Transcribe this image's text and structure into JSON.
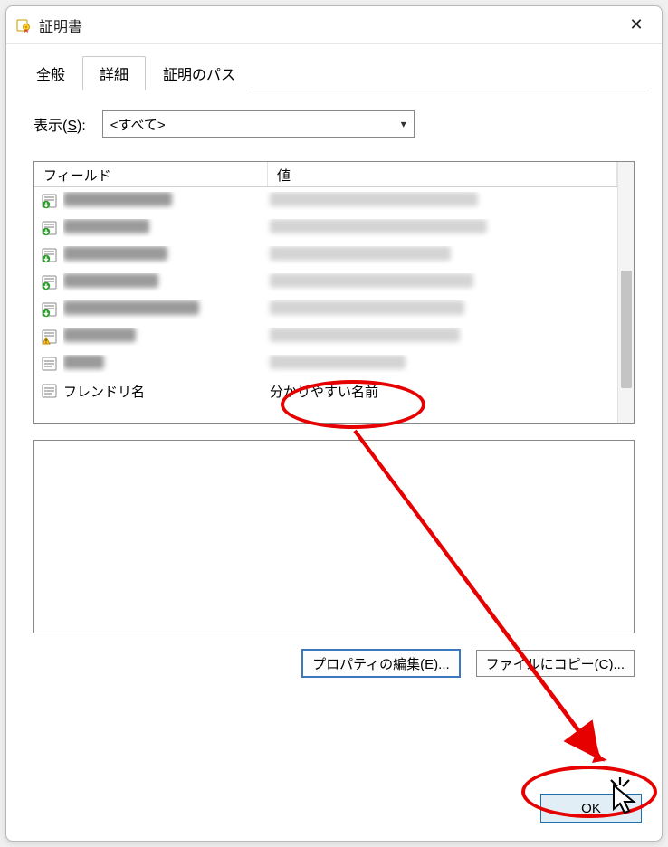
{
  "window": {
    "title": "証明書",
    "close_char": "✕"
  },
  "tabs": {
    "items": [
      {
        "label": "全般"
      },
      {
        "label": "詳細",
        "active": true
      },
      {
        "label": "証明のパス"
      }
    ]
  },
  "show": {
    "label_prefix": "表示(",
    "label_ukey": "S",
    "label_suffix": "):",
    "selected": "<すべて>"
  },
  "columns": {
    "field": "フィールド",
    "value": "値"
  },
  "rows": [
    {
      "icon": "ext-down",
      "field_blurred": true,
      "fw": 120,
      "vw": 230
    },
    {
      "icon": "ext-down",
      "field_blurred": true,
      "fw": 95,
      "vw": 240
    },
    {
      "icon": "ext-down",
      "field_blurred": true,
      "fw": 115,
      "vw": 200
    },
    {
      "icon": "ext-down",
      "field_blurred": true,
      "fw": 105,
      "vw": 225
    },
    {
      "icon": "ext-down",
      "field_blurred": true,
      "fw": 150,
      "vw": 215
    },
    {
      "icon": "ext-warn",
      "field_blurred": true,
      "fw": 80,
      "vw": 210
    },
    {
      "icon": "ext-plain",
      "field_blurred": true,
      "fw": 45,
      "vw": 150
    },
    {
      "icon": "ext-plain",
      "field_blurred": false,
      "field_text": "フレンドリ名",
      "value_blurred": false,
      "value_text": "分かりやすい名前"
    }
  ],
  "buttons": {
    "edit_props": "プロパティの編集(E)...",
    "copy_file": "ファイルにコピー(C)...",
    "ok": "OK"
  }
}
